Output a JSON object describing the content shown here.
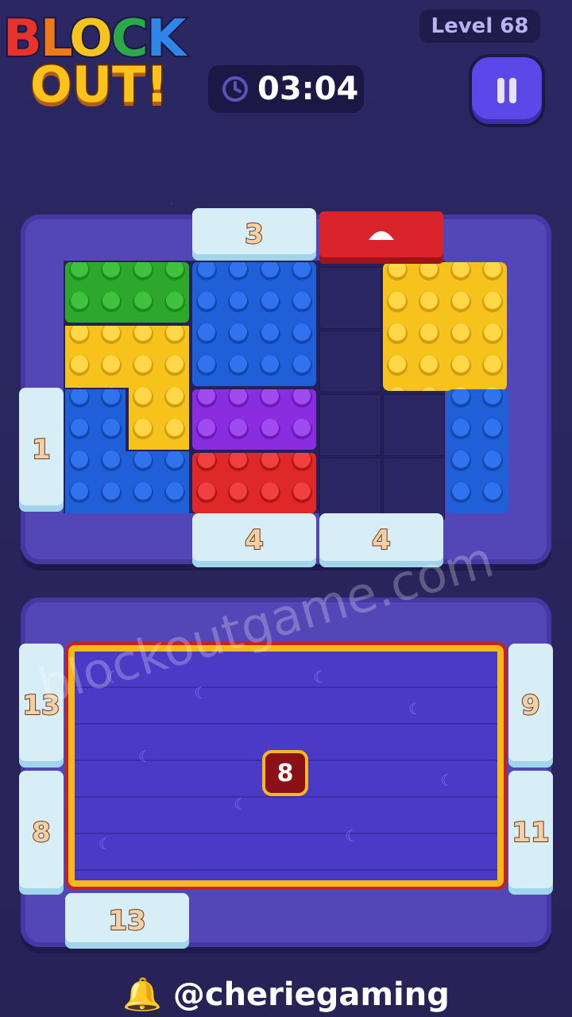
{
  "header": {
    "logo_line1": "BLOCK",
    "logo_line2": "OUT!",
    "level": "Level 68",
    "timer": "03:04",
    "pause_icon": "pause-icon",
    "clock_icon": "clock-icon"
  },
  "top_board": {
    "gate_top": "3",
    "gate_left": "1",
    "gate_bottom_1": "4",
    "gate_bottom_2": "4"
  },
  "bottom_board": {
    "tray_value": "8",
    "gate_left_1": "13",
    "gate_left_2": "8",
    "gate_right_1": "9",
    "gate_right_2": "11",
    "gate_bottom": "13"
  },
  "watermark": "blockoutgame.com",
  "footer": {
    "handle": "@cheriegaming",
    "bell_icon": "bell-icon"
  },
  "colors": {
    "green": "#2ea82c",
    "yellow": "#f6c21c",
    "blue": "#1f5fd8",
    "purple": "#8a2de0",
    "red": "#e02828"
  }
}
